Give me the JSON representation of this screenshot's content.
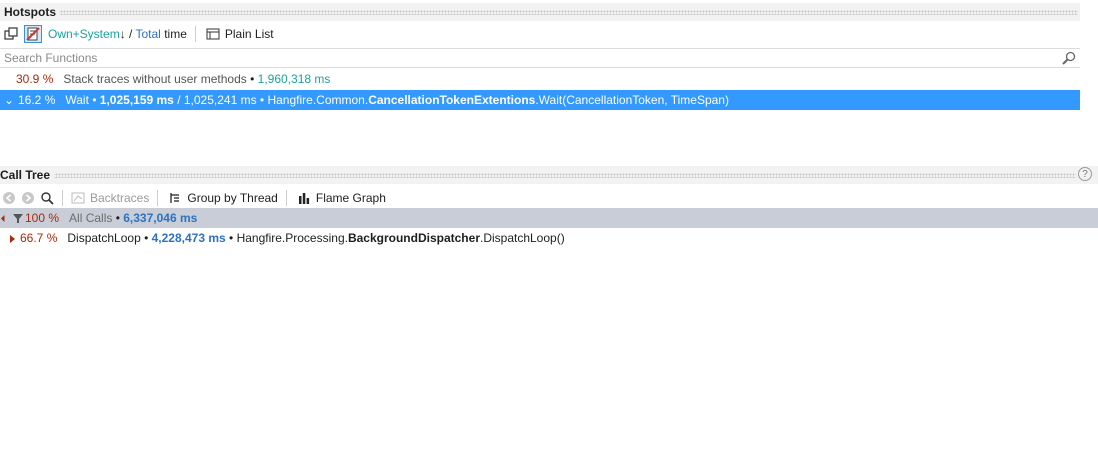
{
  "hotspots": {
    "title": "Hotspots",
    "toolbar": {
      "own_system": "Own+System",
      "sort_arrow": "↓",
      "slash": " / ",
      "total": "Total",
      "time": " time",
      "plain_list": "Plain List"
    },
    "search_placeholder": "Search Functions",
    "rows": [
      {
        "percent": "30.9 %",
        "name": "Stack traces without user methods",
        "sep": " • ",
        "time": "1,960,318 ms"
      },
      {
        "chevron": "⌄",
        "percent": "16.2 %",
        "name": "Wait",
        "sep1": " • ",
        "own_time": "1,025,159 ms",
        "slash": " / ",
        "total_time": "1,025,241 ms",
        "sep2": " • ",
        "ns_prefix": "Hangfire.Common.",
        "class_name": "CancellationTokenExtentions",
        "method_sig": ".Wait(CancellationToken, TimeSpan)"
      }
    ]
  },
  "call_tree": {
    "title": "Call Tree",
    "help": "?",
    "toolbar": {
      "backtraces": "Backtraces",
      "group_by_thread": "Group by Thread",
      "flame_graph": "Flame Graph"
    },
    "rows": [
      {
        "percent": "100 %",
        "name": "All Calls",
        "sep": " • ",
        "time": "6,337,046 ms"
      },
      {
        "percent": "66.7 %",
        "name": "DispatchLoop",
        "sep1": " • ",
        "time": "4,228,473 ms",
        "sep2": " • ",
        "ns_prefix": "Hangfire.Processing.",
        "class_name": "BackgroundDispatcher",
        "method": ".DispatchLoop()"
      }
    ]
  },
  "colors": {
    "accent_teal": "#1aa39a",
    "accent_blue": "#2b73c1",
    "percent_red": "#a62b0d",
    "selection": "#3399ff",
    "header_gray": "#c9cdd8"
  },
  "icons": [
    "copy-icon",
    "filter-user-code-icon",
    "plain-list-icon",
    "search-icon",
    "back-icon",
    "forward-icon",
    "zoom-icon",
    "backtraces-icon",
    "group-by-thread-icon",
    "flame-graph-icon",
    "help-icon",
    "expand-chevron-icon",
    "collapse-triangle-icon"
  ]
}
